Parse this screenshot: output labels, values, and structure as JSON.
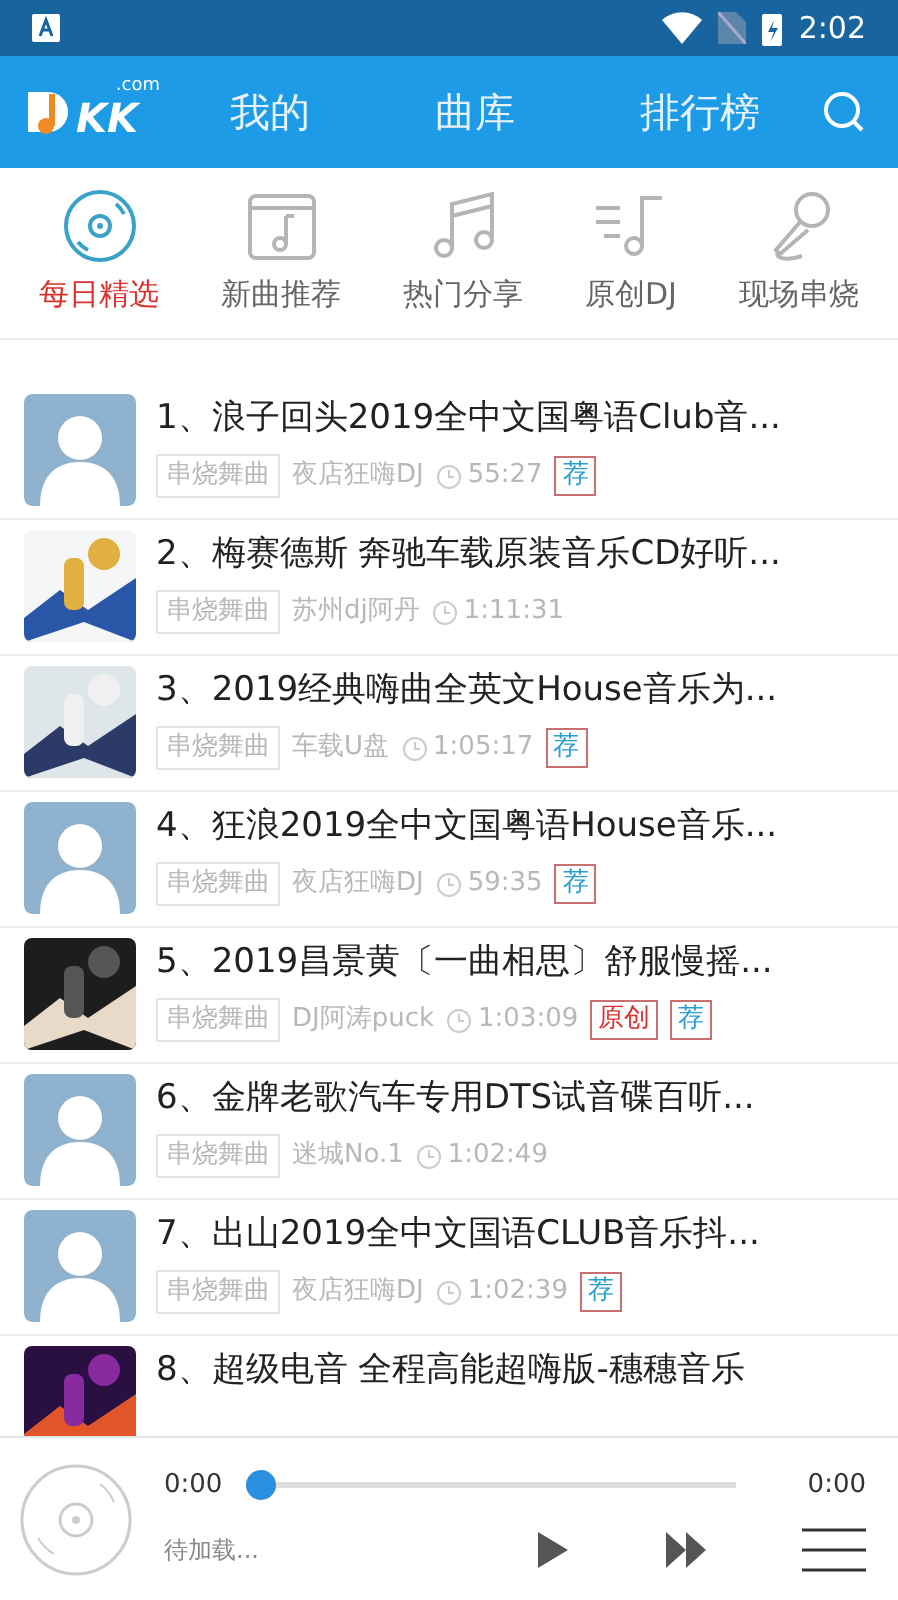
{
  "status_bar": {
    "time": "2:02"
  },
  "header": {
    "tabs": [
      {
        "label": "我的",
        "selected": false
      },
      {
        "label": "曲库",
        "selected": false
      },
      {
        "label": "排行榜",
        "selected": false
      }
    ]
  },
  "logo": {
    "text": "KK",
    "suffix": ".com"
  },
  "categories": [
    {
      "label": "每日精选",
      "selected": true,
      "kind": "disc"
    },
    {
      "label": "新曲推荐",
      "selected": false,
      "kind": "calendar"
    },
    {
      "label": "热门分享",
      "selected": false,
      "kind": "notes"
    },
    {
      "label": "原创DJ",
      "selected": false,
      "kind": "lines"
    },
    {
      "label": "现场串烧",
      "selected": false,
      "kind": "mic"
    }
  ],
  "songs": [
    {
      "title": "1、浪子回头2019全中文国粤语Club音...",
      "genre": "串烧舞曲",
      "artist": "夜店狂嗨DJ",
      "duration": "55:27",
      "kind": "placeholder",
      "tags": [
        {
          "label": "荐",
          "kind": "recommend"
        }
      ]
    },
    {
      "title": "2、梅赛德斯 奔驰车载原装音乐CD好听...",
      "genre": "串烧舞曲",
      "artist": "苏州dj阿丹",
      "duration": "1:11:31",
      "kind": "picture"
    },
    {
      "title": "3、2019经典嗨曲全英文House音乐为...",
      "genre": "串烧舞曲",
      "artist": "车载U盘",
      "duration": "1:05:17",
      "kind": "picture",
      "tags": [
        {
          "label": "荐",
          "kind": "recommend"
        }
      ]
    },
    {
      "title": "4、狂浪2019全中文国粤语House音乐...",
      "genre": "串烧舞曲",
      "artist": "夜店狂嗨DJ",
      "duration": "59:35",
      "kind": "placeholder",
      "tags": [
        {
          "label": "荐",
          "kind": "recommend"
        }
      ]
    },
    {
      "title": "5、2019昌景黄〔一曲相思〕舒服慢摇...",
      "genre": "串烧舞曲",
      "artist": "DJ阿涛puck",
      "duration": "1:03:09",
      "kind": "picture",
      "tags": [
        {
          "label": "原创",
          "kind": "original"
        },
        {
          "label": "荐",
          "kind": "recommend"
        }
      ]
    },
    {
      "title": "6、金牌老歌汽车专用DTS试音碟百听...",
      "genre": "串烧舞曲",
      "artist": "迷城No.1",
      "duration": "1:02:49",
      "kind": "placeholder"
    },
    {
      "title": "7、出山2019全中文国语CLUB音乐抖...",
      "genre": "串烧舞曲",
      "artist": "夜店狂嗨DJ",
      "duration": "1:02:39",
      "kind": "placeholder",
      "tags": [
        {
          "label": "荐",
          "kind": "recommend"
        }
      ]
    },
    {
      "title": "8、超级电音 全程高能超嗨版-穗穗音乐",
      "kind": "picture"
    }
  ],
  "player": {
    "elapsed": "0:00",
    "total": "0:00",
    "level": 0,
    "status": "待加载..."
  }
}
